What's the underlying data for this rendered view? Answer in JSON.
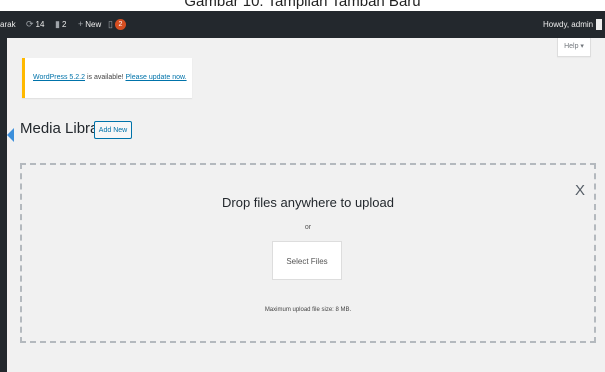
{
  "caption": "Gambar 10. Tampilan Tambah Baru",
  "admin_bar": {
    "site_name_fragment": "arak",
    "updates_count": "14",
    "comments_count": "2",
    "new_label": "New",
    "notification_count": "2",
    "greeting": "Howdy, admin"
  },
  "help_tab": {
    "label": "Help ▾"
  },
  "notice": {
    "link_text": "WordPress 5.2.2",
    "middle_text": " is available! ",
    "update_link": "Please update now.",
    "accent_color": "#ffb900"
  },
  "page": {
    "title": "Media Library",
    "add_new_label": "Add New"
  },
  "uploader": {
    "close_glyph": "X",
    "drop_text": "Drop files anywhere to upload",
    "or_text": "or",
    "select_button": "Select Files",
    "max_size_text": "Maximum upload file size: 8 MB."
  },
  "icons": {
    "updates": "updates-icon",
    "comments": "comment-icon",
    "new": "plus-icon",
    "notification": "bell-icon"
  }
}
